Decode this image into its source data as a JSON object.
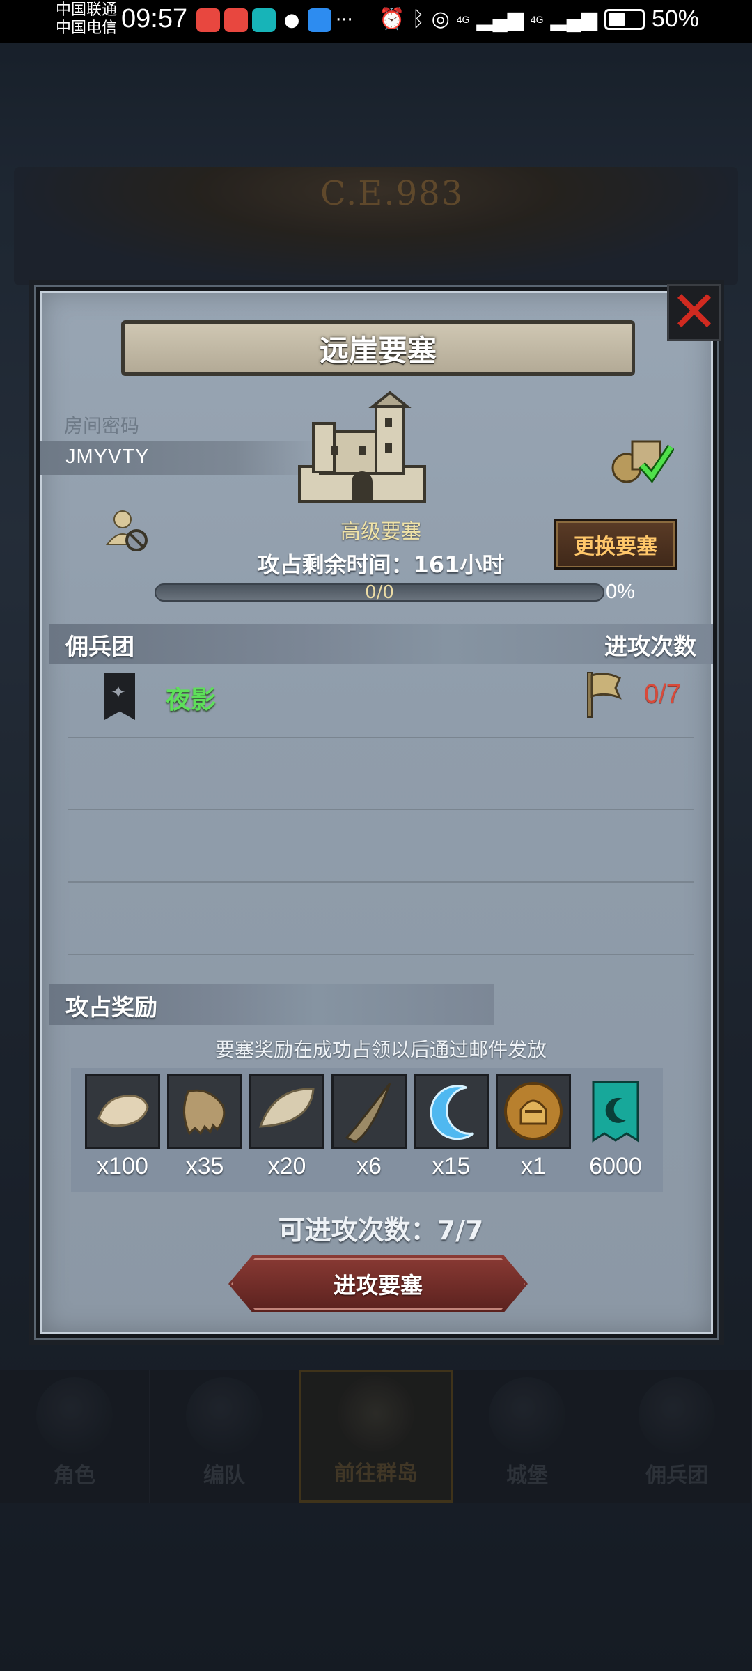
{
  "status_bar": {
    "carrier1": "中国联通",
    "carrier2": "中国电信",
    "time": "09:57",
    "app_icons": [
      "HUAWEI",
      "HUAWEI",
      "Tap",
      "WeChat",
      "Bird"
    ],
    "more": "···",
    "net1": "4G",
    "net2": "4G",
    "battery": "50%"
  },
  "background": {
    "year": "C.E.983"
  },
  "dialog": {
    "title": "远崖要塞",
    "close_symbol": "✕",
    "room_label": "房间密码",
    "room_code": "JMYVTY",
    "fortress_level": "高级要塞",
    "switch_button": "更换要塞",
    "remaining_time": "攻占剩余时间：161小时",
    "progress": {
      "text": "0/0",
      "percent_label": "0%",
      "fraction": 0
    },
    "mercenary_header": "佣兵团",
    "attack_count_header": "进攻次数",
    "mercenary": {
      "name": "夜影",
      "attacks": "0/7"
    },
    "reward_header": "攻占奖励",
    "reward_note": "要塞奖励在成功占领以后通过邮件发放",
    "rewards": [
      {
        "icon": "fur-pelt-icon",
        "qty": "x100"
      },
      {
        "icon": "claw-icon",
        "qty": "x35"
      },
      {
        "icon": "feather-pelt-icon",
        "qty": "x20"
      },
      {
        "icon": "horn-icon",
        "qty": "x6"
      },
      {
        "icon": "crescent-crystal-icon",
        "qty": "x15"
      },
      {
        "icon": "knight-medal-icon",
        "qty": "x1"
      },
      {
        "icon": "banner-currency-icon",
        "qty": "6000"
      }
    ],
    "available_attacks": "可进攻次数：7/7",
    "attack_button": "进攻要塞"
  },
  "bottom_nav": [
    {
      "label": "角色",
      "active": false
    },
    {
      "label": "编队",
      "active": false
    },
    {
      "label": "前往群岛",
      "active": true
    },
    {
      "label": "城堡",
      "active": false
    },
    {
      "label": "佣兵团",
      "active": false
    }
  ],
  "colors": {
    "accent_gold": "#ffc76a",
    "merc_green": "#5ee05a",
    "count_red": "#d94a3a",
    "close_red": "#d02a20"
  }
}
